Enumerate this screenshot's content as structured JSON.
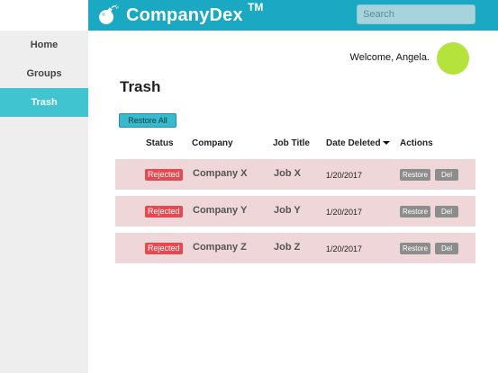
{
  "header": {
    "brand": "CompanyDex",
    "trademark": "TM",
    "search_placeholder": "Search"
  },
  "sidebar": {
    "items": [
      {
        "label": "Home"
      },
      {
        "label": "Groups"
      },
      {
        "label": "Trash",
        "active": true
      }
    ]
  },
  "user": {
    "welcome": "Welcome, Angela."
  },
  "main": {
    "title": "Trash",
    "restore_all_label": "Restore All",
    "columns": {
      "status": "Status",
      "company": "Company",
      "job_title": "Job Title",
      "date_deleted": "Date Deleted",
      "actions": "Actions"
    },
    "rows": [
      {
        "status": "Rejected",
        "company": "Company X",
        "job_title": "Job X",
        "date_deleted": "1/20/2017",
        "restore": "Restore",
        "del": "Del"
      },
      {
        "status": "Rejected",
        "company": "Company Y",
        "job_title": "Job Y",
        "date_deleted": "1/20/2017",
        "restore": "Restore",
        "del": "Del"
      },
      {
        "status": "Rejected",
        "company": "Company Z",
        "job_title": "Job Z",
        "date_deleted": "1/20/2017",
        "restore": "Restore",
        "del": "Del"
      }
    ]
  },
  "colors": {
    "header": "#1aa8c2",
    "sidebar_active": "#3fc4d0",
    "row_bg": "#efd6d8",
    "badge": "#e8484f",
    "avatar": "#b5e33b"
  }
}
